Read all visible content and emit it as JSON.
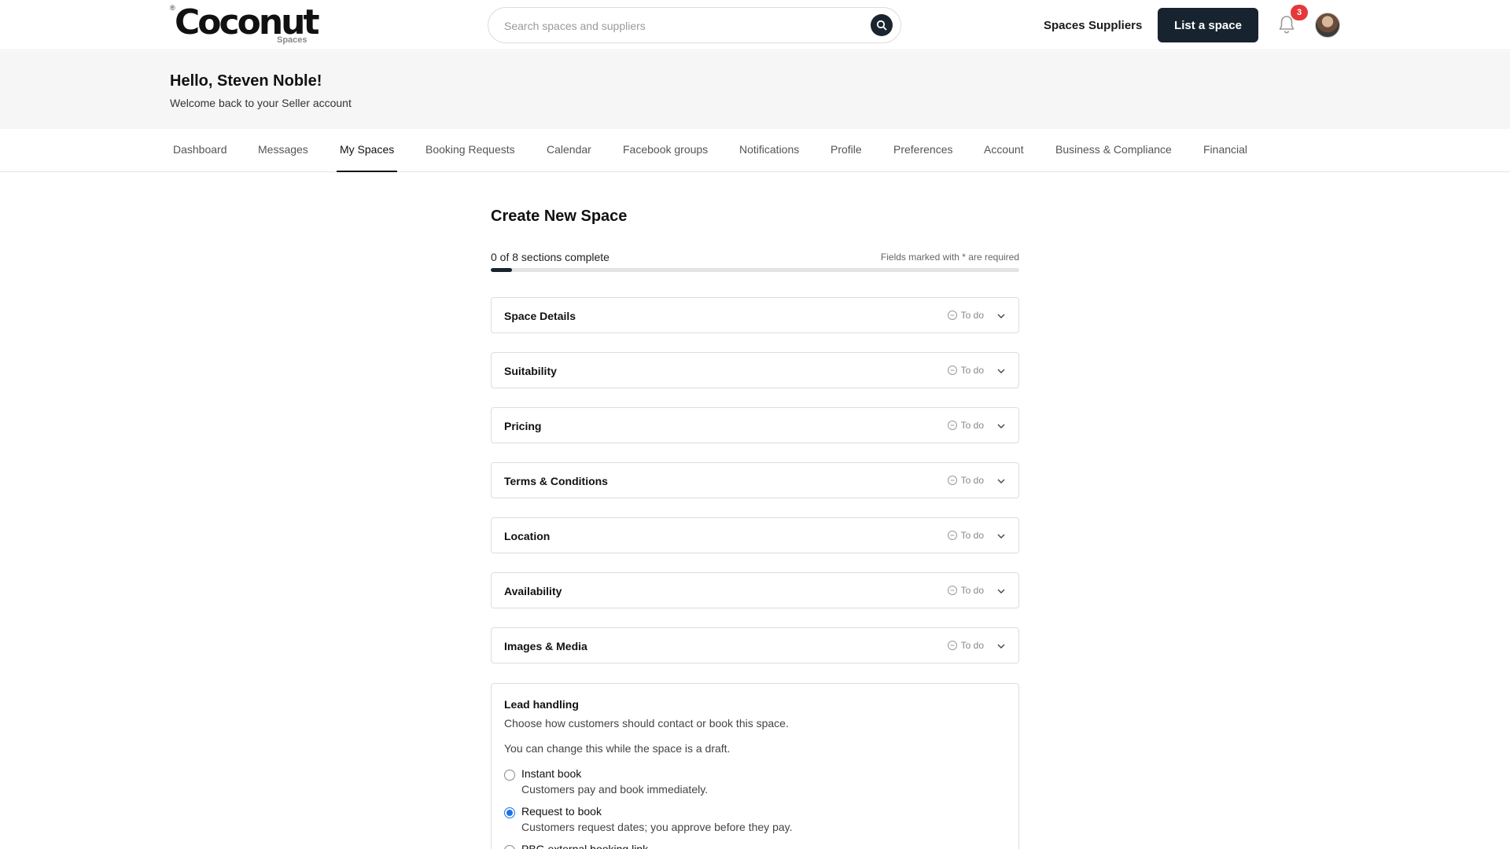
{
  "header": {
    "logo_text": "Coconut",
    "logo_sub": "Spaces",
    "logo_mark": "®",
    "search_placeholder": "Search spaces and suppliers",
    "nav": [
      "Spaces",
      "Suppliers"
    ],
    "cta_label": "List a space",
    "notification_count": "3"
  },
  "greeting": {
    "title": "Hello, Steven Noble!",
    "subtitle": "Welcome back to your Seller account"
  },
  "tabs": [
    {
      "label": "Dashboard"
    },
    {
      "label": "Messages"
    },
    {
      "label": "My Spaces",
      "active": true
    },
    {
      "label": "Booking Requests"
    },
    {
      "label": "Calendar"
    },
    {
      "label": "Facebook groups"
    },
    {
      "label": "Notifications"
    },
    {
      "label": "Profile"
    },
    {
      "label": "Preferences"
    },
    {
      "label": "Account"
    },
    {
      "label": "Business & Compliance"
    },
    {
      "label": "Financial"
    }
  ],
  "form": {
    "title": "Create New Space",
    "progress_text": "0 of 8 sections complete",
    "required_note": "Fields marked with * are required",
    "progress_fraction": 0.04,
    "sections": [
      {
        "title": "Space Details",
        "status": "To do"
      },
      {
        "title": "Suitability",
        "status": "To do"
      },
      {
        "title": "Pricing",
        "status": "To do"
      },
      {
        "title": "Terms & Conditions",
        "status": "To do"
      },
      {
        "title": "Location",
        "status": "To do"
      },
      {
        "title": "Availability",
        "status": "To do"
      },
      {
        "title": "Images & Media",
        "status": "To do"
      }
    ],
    "lead": {
      "title": "Lead handling",
      "desc": "Choose how customers should contact or book this space.",
      "note": "You can change this while the space is a draft.",
      "options": [
        {
          "label": "Instant book",
          "sub": "Customers pay and book immediately.",
          "selected": false
        },
        {
          "label": "Request to book",
          "sub": "Customers request dates; you approve before they pay.",
          "selected": true
        },
        {
          "label": "PBG external booking link",
          "sub": "",
          "selected": false
        }
      ]
    }
  },
  "colors": {
    "primary_dark": "#17232e",
    "badge_red": "#e5383b",
    "radio_blue": "#1a73e8"
  },
  "icons": [
    "search-icon",
    "bell-icon",
    "status-todo-icon",
    "chevron-down-icon"
  ]
}
